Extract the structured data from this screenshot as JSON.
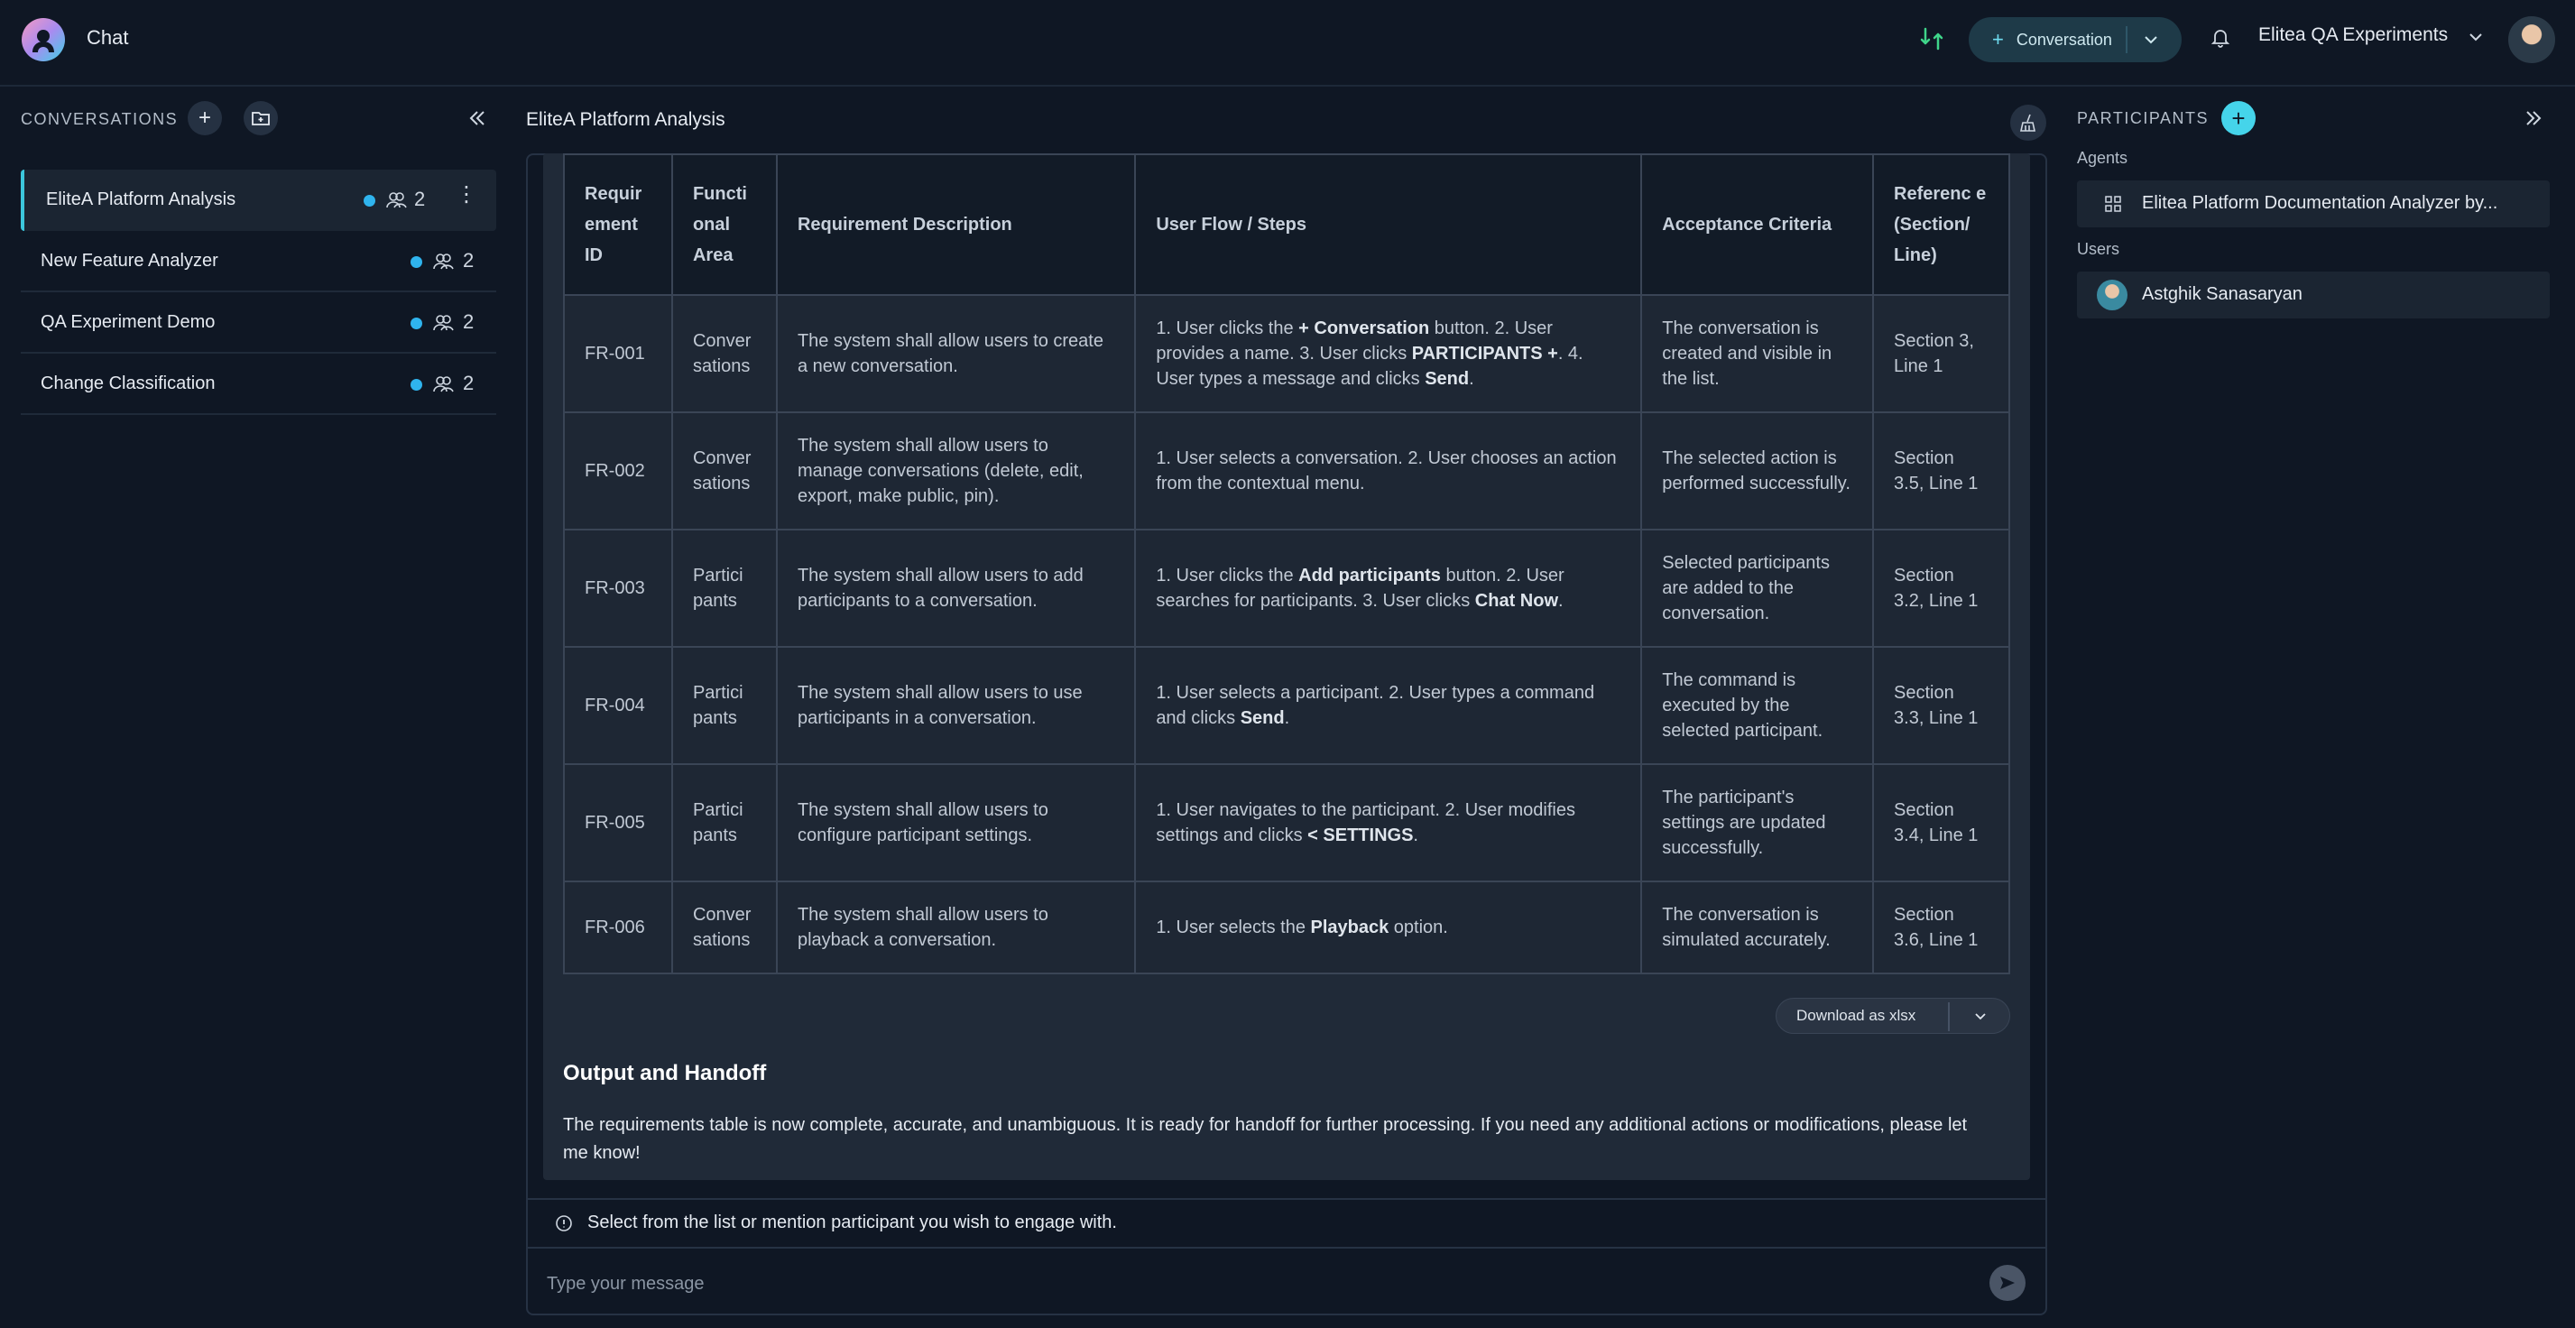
{
  "header": {
    "app_title": "Chat",
    "new_button_label": "Conversation",
    "project_name": "Elitea QA Experiments"
  },
  "sidebar": {
    "heading": "CONVERSATIONS",
    "items": [
      {
        "name": "EliteA Platform Analysis",
        "participants": "2",
        "active": true
      },
      {
        "name": "New Feature Analyzer",
        "participants": "2"
      },
      {
        "name": "QA Experiment Demo",
        "participants": "2"
      },
      {
        "name": "Change Classification",
        "participants": "2"
      }
    ]
  },
  "main": {
    "title": "EliteA Platform Analysis",
    "table": {
      "headers": [
        "Requir ement ID",
        "Functi onal Area",
        "Requirement Description",
        "User Flow / Steps",
        "Acceptance Criteria",
        "Referenc e (Section/ Line)"
      ],
      "rows": [
        {
          "id": "FR-001",
          "area": "Conver sations",
          "desc": "The system shall allow users to create a new conversation.",
          "flow": "1. User clicks the <b>+ Conversation</b> button. 2. User provides a name. 3. User clicks <b>PARTICIPANTS +</b>. 4. User types a message and clicks <b>Send</b>.",
          "criteria": "The conversation is created and visible in the list.",
          "ref": "Section 3, Line 1"
        },
        {
          "id": "FR-002",
          "area": "Conver sations",
          "desc": "The system shall allow users to manage conversations (delete, edit, export, make public, pin).",
          "flow": "1. User selects a conversation. 2. User chooses an action from the contextual menu.",
          "criteria": "The selected action is performed successfully.",
          "ref": "Section 3.5, Line 1"
        },
        {
          "id": "FR-003",
          "area": "Partici pants",
          "desc": "The system shall allow users to add participants to a conversation.",
          "flow": "1. User clicks the <b>Add participants</b> button. 2. User searches for participants. 3. User clicks <b>Chat Now</b>.",
          "criteria": "Selected participants are added to the conversation.",
          "ref": "Section 3.2, Line 1"
        },
        {
          "id": "FR-004",
          "area": "Partici pants",
          "desc": "The system shall allow users to use participants in a conversation.",
          "flow": "1. User selects a participant. 2. User types a command and clicks <b>Send</b>.",
          "criteria": "The command is executed by the selected participant.",
          "ref": "Section 3.3, Line 1"
        },
        {
          "id": "FR-005",
          "area": "Partici pants",
          "desc": "The system shall allow users to configure participant settings.",
          "flow": "1. User navigates to the participant. 2. User modifies settings and clicks <b>&lt; SETTINGS</b>.",
          "criteria": "The participant's settings are updated successfully.",
          "ref": "Section 3.4, Line 1"
        },
        {
          "id": "FR-006",
          "area": "Conver sations",
          "desc": "The system shall allow users to playback a conversation.",
          "flow": "1. User selects the <b>Playback</b> option.",
          "criteria": "The conversation is simulated accurately.",
          "ref": "Section 3.6, Line 1"
        }
      ]
    },
    "download_label": "Download as xlsx",
    "output_heading": "Output and Handoff",
    "output_text": "The requirements table is now complete, accurate, and unambiguous. It is ready for handoff for further processing. If you need any additional actions or modifications, please let me know!",
    "hint": "Select from the list or mention participant you wish to engage with.",
    "input_placeholder": "Type your message"
  },
  "participants": {
    "heading": "PARTICIPANTS",
    "agents_label": "Agents",
    "agents": [
      "Elitea Platform  Documentation Analyzer  by..."
    ],
    "users_label": "Users",
    "users": [
      "Astghik Sanasaryan"
    ]
  },
  "colors": {
    "background": "#0f1724",
    "accent": "#45d4ea",
    "status_dot": "#2fb4ee"
  }
}
